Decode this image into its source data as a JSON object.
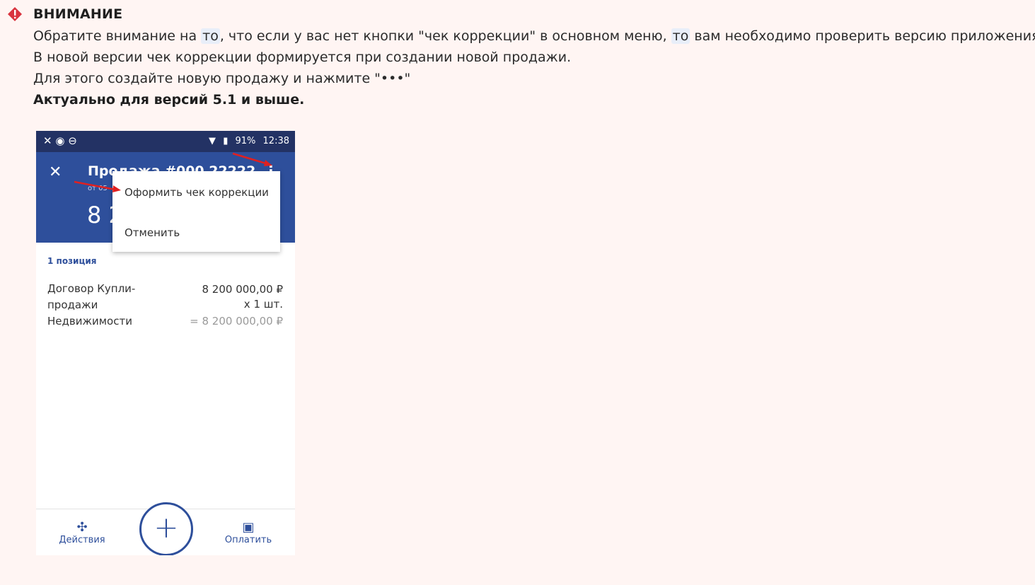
{
  "callout": {
    "title": "ВНИМАНИЕ",
    "icon": "exclamation-icon",
    "accent_color": "#d9343f",
    "line1_a": "Обратите внимание на ",
    "line1_hl1": "то",
    "line1_b": ", что если у вас нет кнопки \"чек коррекции\" в основном меню, ",
    "line1_hl2": "то",
    "line1_c": " вам необходимо проверить версию приложения.",
    "line2": "В новой версии чек коррекции формируется при создании новой продажи.",
    "line3": "Для этого создайте новую продажу и нажмите \"•••\"",
    "line4": "Актуально для версий 5.1 и выше."
  },
  "phone": {
    "status_left": "✕ ◉ ⊖",
    "battery": "91%",
    "time": "12:38",
    "appbar_close": "✕",
    "appbar_title": "Продажа #000 22222",
    "appbar_sub": "от 05",
    "amount": "8 2",
    "menu": {
      "item1": "Оформить чек коррекции",
      "item2": "Отменить"
    },
    "positions_label": "1 позиция",
    "item_name": "Договор Купли-продажи Недвижимости",
    "item_price": "8 200 000,00 ₽",
    "item_qty": "x 1 шт.",
    "item_total": "= 8 200 000,00 ₽",
    "bottom": {
      "actions_label": "Действия",
      "pay_label": "Оплатить",
      "fab_symbol": "+"
    },
    "primary_color": "#2e4f9b",
    "statusbar_color": "#233264",
    "arrow_color": "#e02020"
  }
}
